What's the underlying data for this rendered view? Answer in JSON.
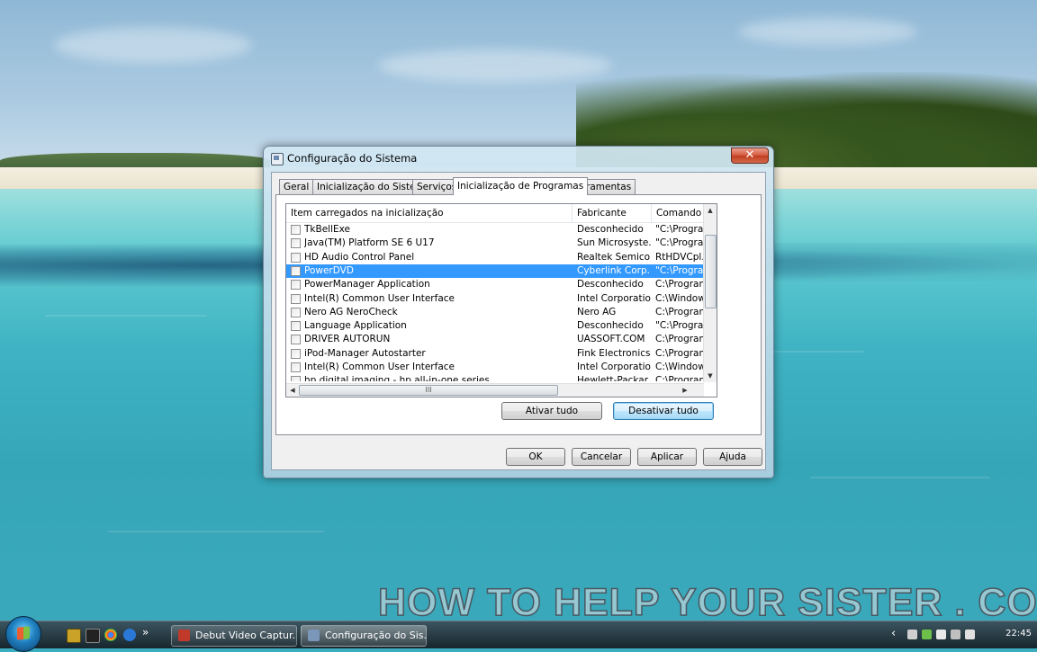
{
  "window": {
    "title": "Configuração do Sistema",
    "close_glyph": "✕",
    "tabs": [
      {
        "label": "Geral",
        "active": false
      },
      {
        "label": "Inicialização do Sistema",
        "active": false
      },
      {
        "label": "Serviços",
        "active": false
      },
      {
        "label": "Inicialização de Programas",
        "active": true
      },
      {
        "label": "Ferramentas",
        "active": false
      }
    ],
    "list": {
      "headers": {
        "item": "Item carregados na inicialização",
        "manufacturer": "Fabricante",
        "command": "Comando"
      },
      "rows": [
        {
          "checked": false,
          "item": "TkBellExe",
          "manufacturer": "Desconhecido",
          "command": "\"C:\\Program",
          "selected": false
        },
        {
          "checked": false,
          "item": "Java(TM) Platform SE 6 U17",
          "manufacturer": "Sun Microsyste...",
          "command": "\"C:\\Program",
          "selected": false
        },
        {
          "checked": false,
          "item": "HD Audio Control Panel",
          "manufacturer": "Realtek Semico...",
          "command": "RtHDVCpl.e",
          "selected": false
        },
        {
          "checked": false,
          "item": "PowerDVD",
          "manufacturer": "Cyberlink Corp.",
          "command": "\"C:\\Program",
          "selected": true
        },
        {
          "checked": false,
          "item": "PowerManager Application",
          "manufacturer": "Desconhecido",
          "command": "C:\\Program",
          "selected": false
        },
        {
          "checked": false,
          "item": "Intel(R) Common User Interface",
          "manufacturer": "Intel Corporation",
          "command": "C:\\Windows",
          "selected": false
        },
        {
          "checked": false,
          "item": "Nero AG NeroCheck",
          "manufacturer": "Nero AG",
          "command": "C:\\Program",
          "selected": false
        },
        {
          "checked": false,
          "item": "Language Application",
          "manufacturer": "Desconhecido",
          "command": "\"C:\\Program",
          "selected": false
        },
        {
          "checked": false,
          "item": "DRIVER AUTORUN",
          "manufacturer": "UASSOFT.COM",
          "command": "C:\\Program",
          "selected": false
        },
        {
          "checked": false,
          "item": "iPod-Manager Autostarter",
          "manufacturer": "Fink Electronics",
          "command": "C:\\Program",
          "selected": false
        },
        {
          "checked": false,
          "item": "Intel(R) Common User Interface",
          "manufacturer": "Intel Corporation",
          "command": "C:\\Windows",
          "selected": false
        },
        {
          "checked": false,
          "item": "hp digital imaging - hp all-in-one series",
          "manufacturer": "Hewlett-Packar...",
          "command": "C:\\Program",
          "selected": false
        }
      ],
      "scroll_up": "▲",
      "scroll_down": "▼",
      "scroll_left": "◀",
      "scroll_right": "▶",
      "hthumb_grip": "III"
    },
    "buttons": {
      "enable_all": "Ativar tudo",
      "disable_all": "Desativar tudo",
      "ok": "OK",
      "cancel": "Cancelar",
      "apply": "Aplicar",
      "help": "Ajuda"
    }
  },
  "taskbar": {
    "quick_launch": [
      "overflow-chevron"
    ],
    "chevron": "»",
    "tasks": [
      {
        "label": "Debut Video Captur...",
        "active": false
      },
      {
        "label": "Configuração do Sis...",
        "active": true
      }
    ],
    "tray_arrow": "‹",
    "clock": "22:45"
  },
  "watermark": "HOW TO HELP YOUR SISTER . COM",
  "colors": {
    "selection": "#3399ff",
    "close_button": "#c13c1f",
    "default_button": "#3c7fb1"
  }
}
